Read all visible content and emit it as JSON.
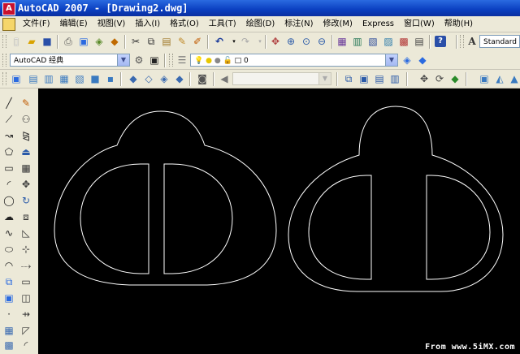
{
  "window": {
    "title": "AutoCAD 2007 - [Drawing2.dwg]",
    "app_icon_text": "A"
  },
  "menu": [
    "文件(F)",
    "编辑(E)",
    "视图(V)",
    "插入(I)",
    "格式(O)",
    "工具(T)",
    "绘图(D)",
    "标注(N)",
    "修改(M)",
    "Express",
    "窗口(W)",
    "帮助(H)"
  ],
  "standard_toolbar": {
    "icons": [
      "new-icon",
      "open-icon",
      "save-icon",
      "print-icon",
      "plot-preview-icon",
      "publish-icon",
      "3d-dwf-icon",
      "cut-icon",
      "copy-icon",
      "paste-icon",
      "match-properties-icon",
      "block-editor-icon",
      "undo-icon",
      "redo-icon",
      "pan-icon",
      "zoom-realtime-icon",
      "zoom-window-icon",
      "zoom-previous-icon",
      "properties-icon",
      "design-center-icon",
      "tool-palettes-icon",
      "sheet-set-icon",
      "markup-icon",
      "calculator-icon",
      "help-icon"
    ],
    "text_style_value": "Standard"
  },
  "workspace": {
    "value": "AutoCAD 经典"
  },
  "layer": {
    "value": "0"
  },
  "modeling_toolbar": {
    "disabled_combo_value": ""
  },
  "accent": {
    "canvas_bg": "#000000",
    "title_blue": "#0a3fc0"
  },
  "watermark": "From www.5iMX.com"
}
